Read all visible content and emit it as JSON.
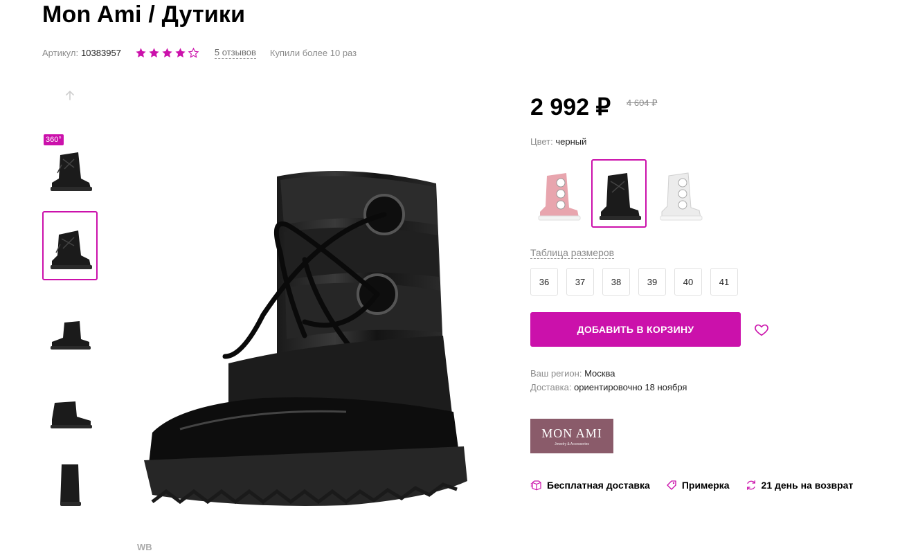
{
  "product": {
    "title": "Mon Ami / Дутики",
    "article_label": "Артикул:",
    "article": "10383957",
    "rating": 4,
    "rating_max": 5,
    "reviews": "5 отзывов",
    "bought": "Купили более 10 раз"
  },
  "gallery": {
    "badge_360": "360°",
    "active_index": 1,
    "thumbs": [
      "boot-front-360",
      "boot-front",
      "boot-side",
      "boot-back-side",
      "boot-back"
    ],
    "brand_mark": "WB"
  },
  "price": {
    "current": "2 992 ₽",
    "old": "4 604 ₽"
  },
  "color": {
    "label": "Цвет:",
    "value": "черный",
    "swatches": [
      "pink",
      "black",
      "white"
    ],
    "active_index": 1
  },
  "sizes": {
    "table_link": "Таблица размеров",
    "options": [
      "36",
      "37",
      "38",
      "39",
      "40",
      "41"
    ]
  },
  "cart": {
    "button": "ДОБАВИТЬ В КОРЗИНУ"
  },
  "delivery": {
    "region_label": "Ваш регион:",
    "region": "Москва",
    "delivery_label": "Доставка:",
    "delivery_value": "ориентировочно 18 ноября"
  },
  "brand": {
    "name": "MON AMI",
    "tagline": "Jewelry & Accessories"
  },
  "features": {
    "free_delivery": "Бесплатная доставка",
    "fitting": "Примерка",
    "return": "21 день на возврат"
  },
  "colors": {
    "accent": "#cb11ab",
    "brand_bg": "#8a5b6a"
  }
}
